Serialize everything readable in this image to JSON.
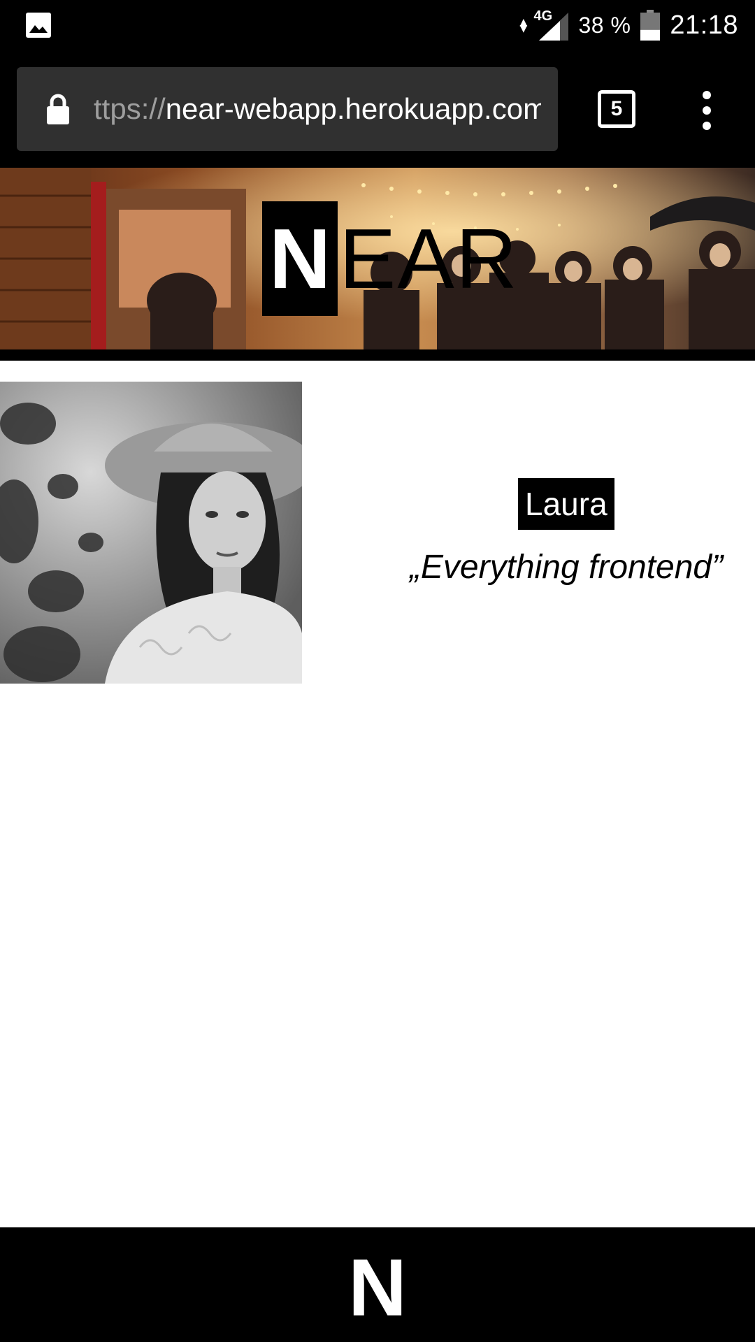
{
  "status_bar": {
    "network": "4G",
    "battery_percent": "38 %",
    "battery_level": 0.38,
    "time": "21:18",
    "icons": [
      "gallery-icon",
      "data-arrows-icon",
      "signal-icon",
      "battery-icon"
    ]
  },
  "browser": {
    "url_scheme": "ttps://",
    "url_host": "near-webapp.herokuapp.com",
    "tab_count": "5",
    "icons": [
      "lock-icon",
      "tab-switcher-icon",
      "overflow-menu-icon"
    ]
  },
  "site": {
    "logo_initial": "N",
    "logo_rest": "EAR",
    "profile": {
      "name": "Laura",
      "quote": "„Everything frontend”"
    },
    "footer_logo": "N"
  },
  "colors": {
    "background": "#ffffff",
    "chrome": "#000000",
    "url_bar": "#303030",
    "url_scheme": "#9e9e9e"
  }
}
